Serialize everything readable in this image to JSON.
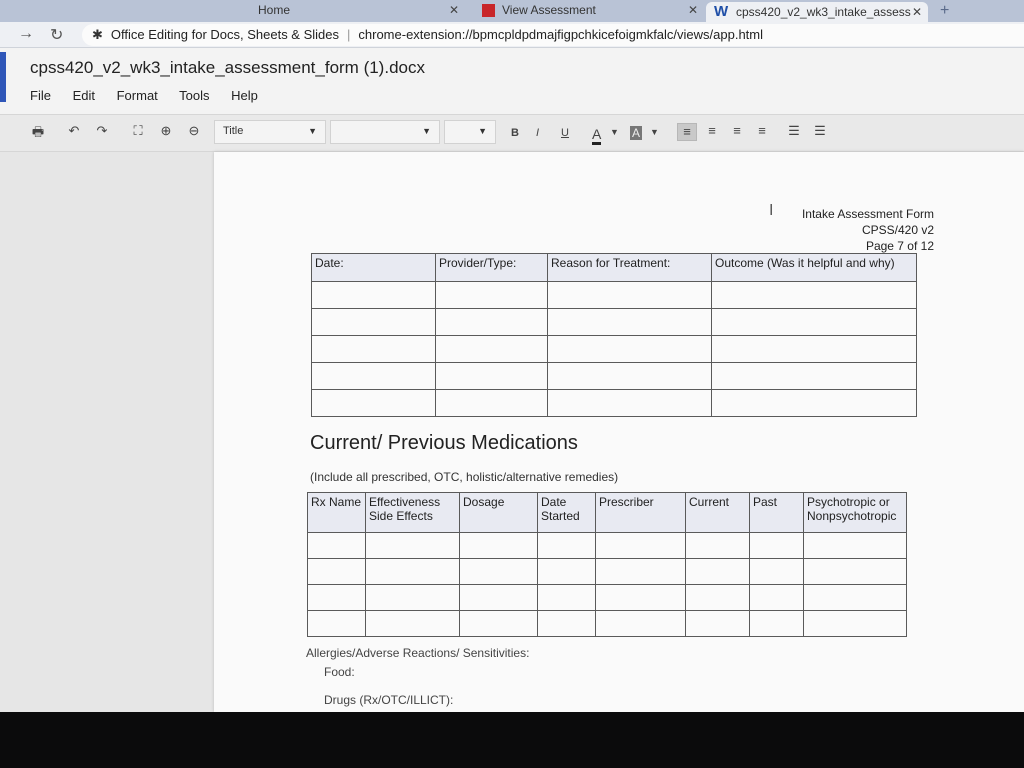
{
  "browser": {
    "tabs": [
      {
        "title": "Home"
      },
      {
        "title": "View Assessment"
      },
      {
        "title": "cpss420_v2_wk3_intake_assess"
      }
    ],
    "extension_name": "Office Editing for Docs, Sheets & Slides",
    "url": "chrome-extension://bpmcpldpdmajfigpchkicefoigmkfalc/views/app.html"
  },
  "app": {
    "doc_title": "cpss420_v2_wk3_intake_assessment_form (1).docx",
    "menu": [
      "File",
      "Edit",
      "Format",
      "Tools",
      "Help"
    ],
    "toolbar": {
      "style_select": "Title",
      "bold": "B",
      "italic": "I",
      "underline": "U",
      "font_color": "A",
      "highlight": "A"
    }
  },
  "document": {
    "header": {
      "line1": "Intake Assessment Form",
      "line2": "CPSS/420 v2",
      "line3": "Page 7 of 12"
    },
    "treatment_table": {
      "columns": [
        "Date:",
        "Provider/Type:",
        "Reason for Treatment:",
        "Outcome (Was it helpful and why)"
      ],
      "empty_rows": 5
    },
    "medications": {
      "title": "Current/ Previous Medications",
      "note": "(Include all prescribed, OTC, holistic/alternative remedies)",
      "columns": [
        "Rx Name",
        "Effectiveness Side Effects",
        "Dosage",
        "Date Started",
        "Prescriber",
        "Current",
        "Past",
        "Psychotropic or Nonpsychotropic"
      ],
      "empty_rows": 4
    },
    "allergies_label": "Allergies/Adverse Reactions/ Sensitivities:",
    "food_label": "Food:",
    "drugs_label": "Drugs (Rx/OTC/ILLICT):"
  }
}
